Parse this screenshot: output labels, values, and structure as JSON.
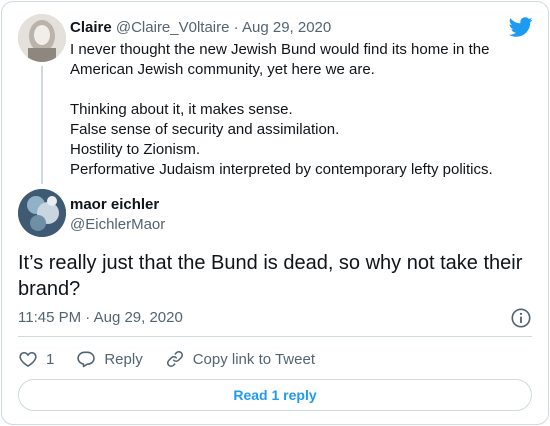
{
  "parent_tweet": {
    "name": "Claire",
    "handle": "@Claire_V0ltaire",
    "separator": "·",
    "date": "Aug 29, 2020",
    "paragraph_1": "I never thought the new Jewish Bund would find its home in the American Jewish community, yet here we are.",
    "lines": [
      "Thinking about it, it makes sense.",
      "False sense of security and assimilation.",
      "Hostility to Zionism.",
      "Performative Judaism interpreted by contemporary lefty politics."
    ]
  },
  "main_tweet": {
    "name": "maor eichler",
    "handle": "@EichlerMaor",
    "text": "It’s really just that the Bund is dead, so why not take their brand?",
    "timestamp": "11:45 PM · Aug 29, 2020"
  },
  "actions": {
    "like_count": "1",
    "reply_label": "Reply",
    "copy_link_label": "Copy link to Tweet"
  },
  "read_replies_label": "Read 1 reply",
  "icons": {
    "brand": "twitter-bird-icon",
    "info": "info-icon",
    "like": "heart-icon",
    "reply": "reply-bubble-icon",
    "link": "link-icon"
  },
  "colors": {
    "accent": "#1d9bf0",
    "muted": "#536471",
    "border": "#cfd9de"
  }
}
